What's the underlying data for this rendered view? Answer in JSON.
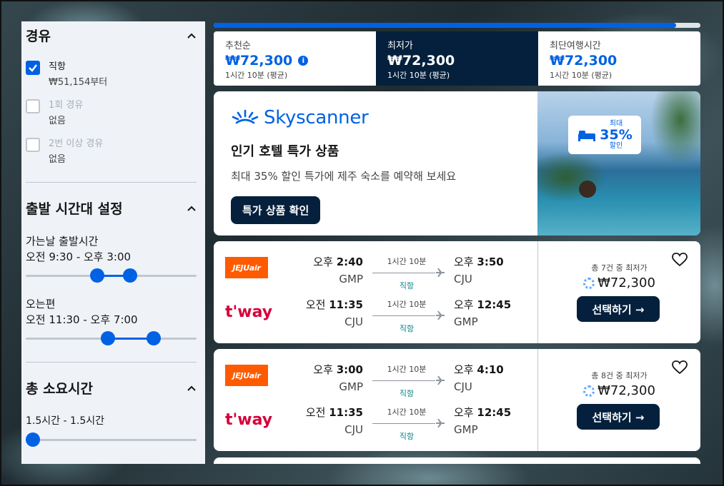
{
  "filters": {
    "stops": {
      "title": "경유",
      "options": [
        {
          "label": "직항",
          "sub": "₩51,154부터",
          "checked": true
        },
        {
          "label": "1회 경유",
          "sub": "없음",
          "checked": false
        },
        {
          "label": "2번 이상 경유",
          "sub": "없음",
          "checked": false
        }
      ]
    },
    "departure": {
      "title": "출발 시간대 설정",
      "outbound": {
        "label": "가는날 출발시간",
        "range": "오전 9:30 - 오후 3:00",
        "from": 0.41,
        "to": 0.62
      },
      "inbound": {
        "label": "오는편",
        "range": "오전 11:30 - 오후 7:00",
        "from": 0.48,
        "to": 0.77
      }
    },
    "duration": {
      "title": "총 소요시간",
      "range": "1.5시간 - 1.5시간",
      "value": 0.0
    }
  },
  "progress": 0.95,
  "sort_tabs": [
    {
      "name": "추천순",
      "price": "₩72,300",
      "duration": "1시간 10분 (평균)",
      "active": false,
      "info": true
    },
    {
      "name": "최저가",
      "price": "₩72,300",
      "duration": "1시간 10분 (평균)",
      "active": true,
      "info": false
    },
    {
      "name": "최단여행시간",
      "price": "₩72,300",
      "duration": "1시간 10분 (평균)",
      "active": false,
      "info": false
    }
  ],
  "ad": {
    "brand": "Skyscanner",
    "title": "인기 호텔 특가 상품",
    "description": "최대 35% 할인 특가에 제주 숙소를 예약해 보세요",
    "button": "특가 상품 확인",
    "badge_top": "최대",
    "badge_big": "35%",
    "badge_bottom": "할인"
  },
  "cards": [
    {
      "deal": "총 7건 중 최저가",
      "price": "₩72,300",
      "button": "선택하기 →",
      "legs": [
        {
          "airline": "JEJUair",
          "dep_prefix": "오후",
          "dep_time": "2:40",
          "dep_code": "GMP",
          "duration": "1시간 10분",
          "stops": "직항",
          "arr_prefix": "오후",
          "arr_time": "3:50",
          "arr_code": "CJU"
        },
        {
          "airline": "t'way",
          "dep_prefix": "오전",
          "dep_time": "11:35",
          "dep_code": "CJU",
          "duration": "1시간 10분",
          "stops": "직항",
          "arr_prefix": "오후",
          "arr_time": "12:45",
          "arr_code": "GMP"
        }
      ]
    },
    {
      "deal": "총 8건 중 최저가",
      "price": "₩72,300",
      "button": "선택하기 →",
      "legs": [
        {
          "airline": "JEJUair",
          "dep_prefix": "오후",
          "dep_time": "3:00",
          "dep_code": "GMP",
          "duration": "1시간 10분",
          "stops": "직항",
          "arr_prefix": "오후",
          "arr_time": "4:10",
          "arr_code": "CJU"
        },
        {
          "airline": "t'way",
          "dep_prefix": "오전",
          "dep_time": "11:35",
          "dep_code": "CJU",
          "duration": "1시간 10분",
          "stops": "직항",
          "arr_prefix": "오후",
          "arr_time": "12:45",
          "arr_code": "GMP"
        }
      ]
    }
  ],
  "colors": {
    "accent": "#0062e3",
    "dark": "#05203c",
    "stop": "#0c838a",
    "jeju": "#ff5a00",
    "tway": "#d6003a"
  }
}
